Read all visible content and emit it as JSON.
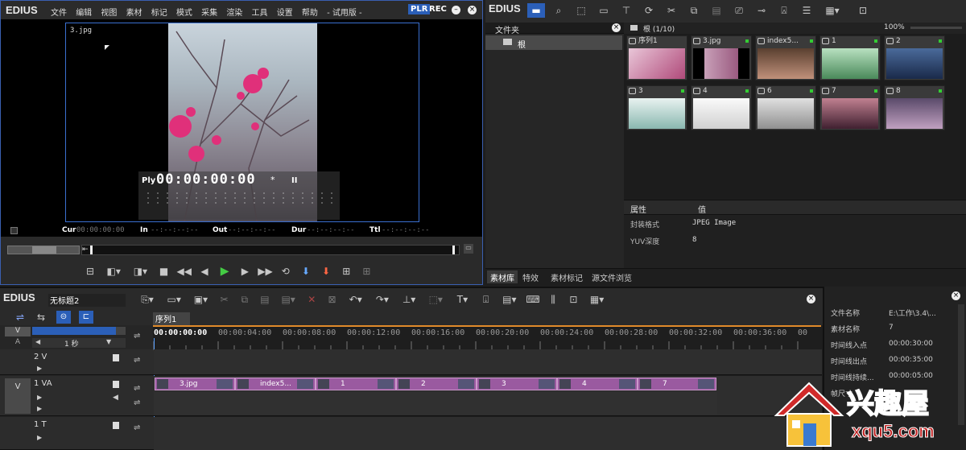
{
  "player": {
    "logo": "EDIUS",
    "menu": [
      "文件",
      "编辑",
      "视图",
      "素材",
      "标记",
      "模式",
      "采集",
      "渲染",
      "工具",
      "设置",
      "帮助",
      "- 试用版 -"
    ],
    "plr": "PLR",
    "rec": "REC",
    "clip_name": "3.jpg",
    "ply_label": "Ply",
    "timecode": "00:00:00:00",
    "tc_suffix": "*",
    "cur_label": "Cur",
    "cur_value": "00:00:00:00",
    "in_label": "In",
    "in_value": "--:--:--:--",
    "out_label": "Out",
    "out_value": "--:--:--:--",
    "dur_label": "Dur",
    "dur_value": "--:--:--:--",
    "ttl_label": "Ttl",
    "ttl_value": "--:--:--:--"
  },
  "bin": {
    "logo": "EDIUS",
    "folder_header": "文件夹",
    "root_folder": "根",
    "path": "根 (1/10)",
    "zoom": "100%",
    "thumbnails": [
      {
        "name": "序列1",
        "kind": "seq"
      },
      {
        "name": "3.jpg",
        "kind": "img"
      },
      {
        "name": "index5...",
        "kind": "img"
      },
      {
        "name": "1",
        "kind": "img"
      },
      {
        "name": "2",
        "kind": "img"
      },
      {
        "name": "3",
        "kind": "img"
      },
      {
        "name": "4",
        "kind": "img"
      },
      {
        "name": "6",
        "kind": "img"
      },
      {
        "name": "7",
        "kind": "img"
      },
      {
        "name": "8",
        "kind": "img"
      }
    ],
    "prop_header": "属性",
    "value_header": "值",
    "props": [
      {
        "k": "封装格式",
        "v": "JPEG Image"
      },
      {
        "k": "YUV深度",
        "v": "8"
      }
    ],
    "tabs": [
      "素材库",
      "特效",
      "素材标记",
      "源文件浏览"
    ]
  },
  "timeline": {
    "logo": "EDIUS",
    "project_name": "无标题2",
    "sequence_tab": "序列1",
    "zoom_label": "1 秒",
    "ruler": [
      "00:00:00:00",
      "00:00:04:00",
      "00:00:08:00",
      "00:00:12:00",
      "00:00:16:00",
      "00:00:20:00",
      "00:00:24:00",
      "00:00:28:00",
      "00:00:32:00",
      "00:00:36:00",
      "00"
    ],
    "v_label": "V",
    "a_label": "A",
    "tracks": [
      {
        "name": "2 V",
        "side": ""
      },
      {
        "name": "1 VA",
        "side": "V"
      },
      {
        "name": "1 T",
        "side": ""
      }
    ],
    "clips": [
      "3.jpg",
      "index5...",
      "1",
      "2",
      "3",
      "4",
      "7"
    ]
  },
  "info": {
    "rows": [
      {
        "k": "文件名称",
        "v": "E:\\工作\\3.4\\..."
      },
      {
        "k": "素材名称",
        "v": "7"
      },
      {
        "k": "时间线入点",
        "v": "00:00:30:00"
      },
      {
        "k": "时间线出点",
        "v": "00:00:35:00"
      },
      {
        "k": "时间线持续...",
        "v": "00:00:05:00"
      },
      {
        "k": "帧尺寸",
        "v": ""
      }
    ]
  },
  "watermark": {
    "cn": "兴趣屋",
    "url": "xqu5.com"
  }
}
